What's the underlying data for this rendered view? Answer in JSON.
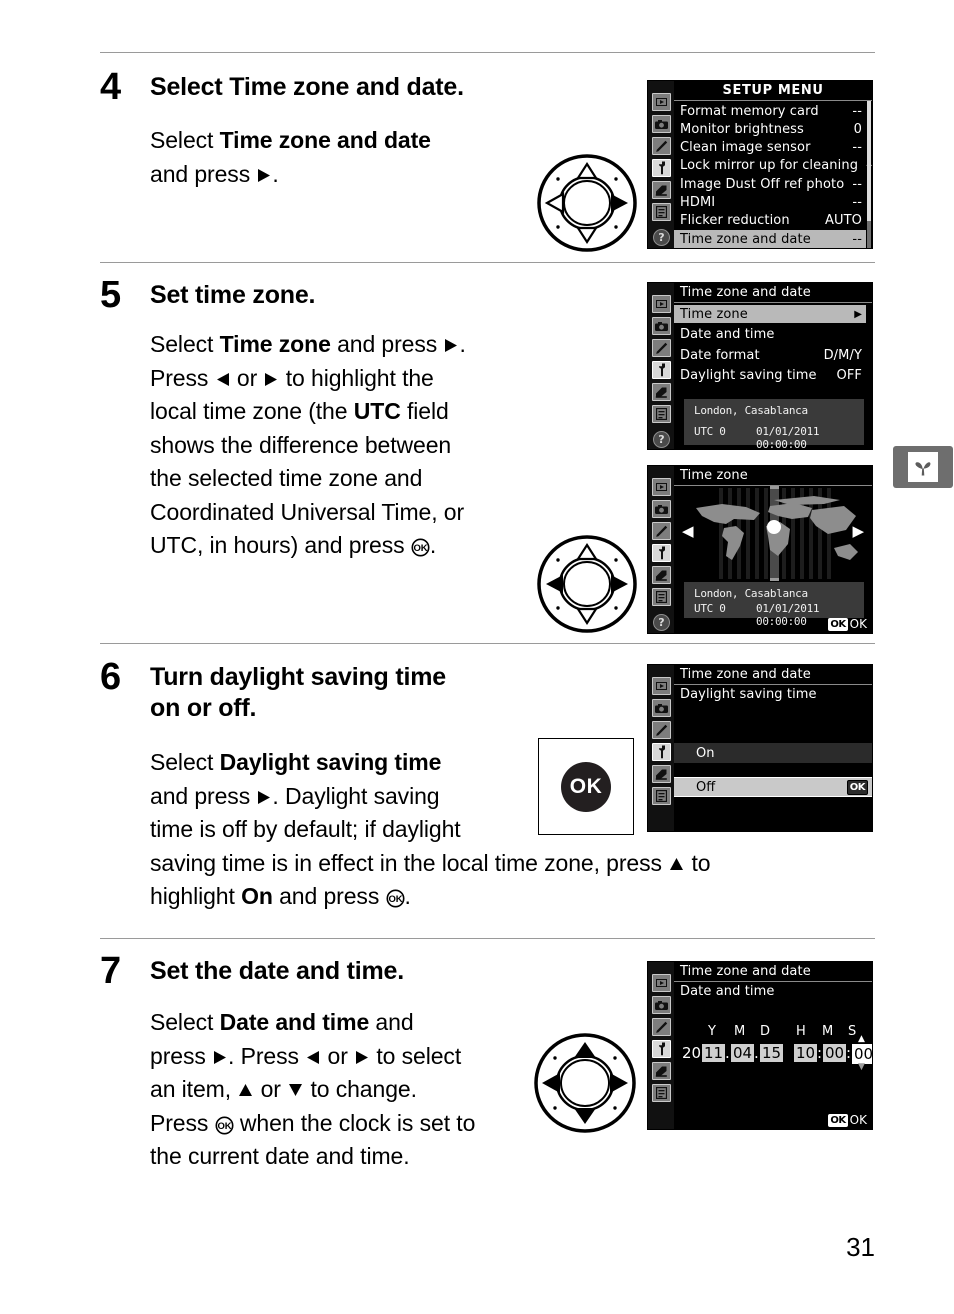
{
  "page": {
    "number": "31"
  },
  "section_tab": {
    "icon": "seedling-icon"
  },
  "steps": [
    {
      "number": "4",
      "heading_parts": [
        {
          "t": "Select ",
          "b": false
        },
        {
          "t": "Time zone and date",
          "b": true
        },
        {
          "t": ".",
          "b": false
        }
      ],
      "body_lines": [
        [
          {
            "t": "Select ",
            "b": false
          },
          {
            "t": "Time zone and date",
            "b": true
          }
        ],
        [
          {
            "t": "and press ",
            "b": false
          },
          {
            "g": "right-arrow"
          },
          {
            "t": ".",
            "b": false
          }
        ]
      ],
      "dial": {
        "up": false,
        "down": false,
        "left": false,
        "right": true
      }
    },
    {
      "number": "5",
      "heading_parts": [
        {
          "t": "Set time zone.",
          "b": true
        }
      ],
      "body_lines": [
        [
          {
            "t": "Select ",
            "b": false
          },
          {
            "t": "Time zone",
            "b": true
          },
          {
            "t": " and press ",
            "b": false
          },
          {
            "g": "right-arrow"
          },
          {
            "t": ".",
            "b": false
          }
        ],
        [
          {
            "t": "Press ",
            "b": false
          },
          {
            "g": "left-arrow"
          },
          {
            "t": " or ",
            "b": false
          },
          {
            "g": "right-arrow"
          },
          {
            "t": " to highlight the",
            "b": false
          }
        ],
        [
          {
            "t": "local time zone (the ",
            "b": false
          },
          {
            "t": "UTC",
            "b": true
          },
          {
            "t": " field",
            "b": false
          }
        ],
        [
          {
            "t": "shows the difference between",
            "b": false
          }
        ],
        [
          {
            "t": "the selected time zone and",
            "b": false
          }
        ],
        [
          {
            "t": "Coordinated Universal Time, or",
            "b": false
          }
        ],
        [
          {
            "t": "UTC, in hours) and press ",
            "b": false
          },
          {
            "g": "ok-glyph"
          },
          {
            "t": ".",
            "b": false
          }
        ]
      ],
      "dial": {
        "up": false,
        "down": false,
        "left": true,
        "right": true
      }
    },
    {
      "number": "6",
      "heading_parts": [
        {
          "t": "Turn daylight saving time",
          "b": true
        }
      ],
      "heading_line2": "on or off.",
      "body_lines": [
        [
          {
            "t": "Select ",
            "b": false
          },
          {
            "t": "Daylight saving time",
            "b": true
          }
        ],
        [
          {
            "t": "and press ",
            "b": false
          },
          {
            "g": "right-arrow"
          },
          {
            "t": ".  Daylight saving",
            "b": false
          }
        ],
        [
          {
            "t": "time is off by default; if daylight",
            "b": false
          }
        ],
        [
          {
            "t": "saving time is in effect in the local time zone, press ",
            "b": false
          },
          {
            "g": "up-arrow"
          },
          {
            "t": " to",
            "b": false
          }
        ],
        [
          {
            "t": "highlight ",
            "b": false
          },
          {
            "t": "On",
            "b": true
          },
          {
            "t": " and press ",
            "b": false
          },
          {
            "g": "ok-glyph"
          },
          {
            "t": ".",
            "b": false
          }
        ]
      ],
      "ok_button": {
        "label": "OK"
      }
    },
    {
      "number": "7",
      "heading_parts": [
        {
          "t": "Set the date and time.",
          "b": true
        }
      ],
      "body_lines": [
        [
          {
            "t": "Select ",
            "b": false
          },
          {
            "t": "Date and time",
            "b": true
          },
          {
            "t": " and",
            "b": false
          }
        ],
        [
          {
            "t": "press ",
            "b": false
          },
          {
            "g": "right-arrow"
          },
          {
            "t": ".  Press ",
            "b": false
          },
          {
            "g": "left-arrow"
          },
          {
            "t": " or ",
            "b": false
          },
          {
            "g": "right-arrow"
          },
          {
            "t": " to select",
            "b": false
          }
        ],
        [
          {
            "t": "an item, ",
            "b": false
          },
          {
            "g": "up-arrow"
          },
          {
            "t": " or ",
            "b": false
          },
          {
            "g": "down-arrow"
          },
          {
            "t": " to change.",
            "b": false
          }
        ],
        [
          {
            "t": "Press ",
            "b": false
          },
          {
            "g": "ok-glyph"
          },
          {
            "t": " when the clock is set to",
            "b": false
          }
        ],
        [
          {
            "t": "the current date and time.",
            "b": false
          }
        ]
      ],
      "dial": {
        "up": true,
        "down": true,
        "left": true,
        "right": true
      }
    }
  ],
  "screens": {
    "setup_menu": {
      "title": "SETUP MENU",
      "sidebar_icons": [
        "playback-icon",
        "shooting-menu-icon",
        "custom-settings-icon",
        "setup-menu-icon",
        "retouch-icon",
        "recent-settings-icon",
        "help-icon"
      ],
      "selected_sidebar_index": 3,
      "rows": [
        {
          "label": "Format memory card",
          "value": "--",
          "highlighted": false
        },
        {
          "label": "Monitor brightness",
          "value": "0",
          "highlighted": false
        },
        {
          "label": "Clean image sensor",
          "value": "--",
          "highlighted": false
        },
        {
          "label": "Lock mirror up for cleaning",
          "value": "--",
          "highlighted": false
        },
        {
          "label": "Image Dust Off ref photo",
          "value": "--",
          "highlighted": false
        },
        {
          "label": "HDMI",
          "value": "--",
          "highlighted": false
        },
        {
          "label": "Flicker reduction",
          "value": "AUTO",
          "highlighted": false
        },
        {
          "label": "Time zone and date",
          "value": "--",
          "highlighted": true
        }
      ]
    },
    "time_zone_and_date": {
      "title": "Time zone and date",
      "rows": [
        {
          "label": "Time zone",
          "value": "",
          "arrow": true,
          "highlighted": true
        },
        {
          "label": "Date and time",
          "value": "",
          "arrow": false,
          "highlighted": false
        },
        {
          "label": "Date format",
          "value": "D/M/Y",
          "arrow": false,
          "highlighted": false
        },
        {
          "label": "Daylight saving time",
          "value": "OFF",
          "arrow": false,
          "highlighted": false
        }
      ],
      "info": {
        "city": "London, Casablanca",
        "utc": "UTC 0",
        "datetime": "01/01/2011 00:00:00"
      }
    },
    "time_zone_map": {
      "title": "Time zone",
      "left_arrow": "◀",
      "right_arrow": "▶",
      "info": {
        "city": "London, Casablanca",
        "utc": "UTC 0",
        "datetime": "01/01/2011 00:00:00"
      },
      "ok_hint": {
        "badge": "OK",
        "label": "OK"
      }
    },
    "daylight_saving": {
      "title": "Time zone and date",
      "subtitle": "Daylight saving time",
      "options": [
        {
          "label": "On",
          "selected": false
        },
        {
          "label": "Off",
          "selected": true,
          "badge": "OK"
        }
      ]
    },
    "date_and_time": {
      "title": "Time zone and date",
      "subtitle": "Date and time",
      "column_labels": [
        "Y",
        "M",
        "D",
        "H",
        "M",
        "S"
      ],
      "year_prefix": "20",
      "values": {
        "year": "11",
        "month": "04",
        "day": "15",
        "hour": "10",
        "minute": "00",
        "second": "00"
      },
      "separators": {
        "date": ".",
        "time": ":"
      },
      "active_field": "second",
      "ok_hint": {
        "badge": "OK",
        "label": "OK"
      }
    }
  },
  "colors": {
    "rule": "#9a9a9a",
    "tab_gray": "#6e6e6e",
    "lcd_bg": "#000000",
    "highlight": "#b9b9b9",
    "info_bg": "#3a3a3a"
  }
}
